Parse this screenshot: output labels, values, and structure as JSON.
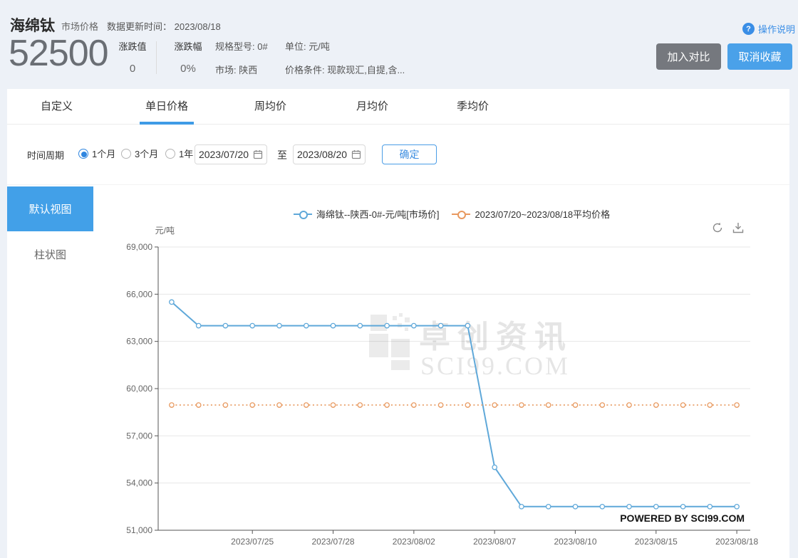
{
  "header": {
    "title": "海绵钛",
    "subtitle": "市场价格",
    "update_label": "数据更新时间：",
    "update_value": "2023/08/18",
    "help_label": "操作说明",
    "price": "52500",
    "change_label": "涨跌值",
    "change_value": "0",
    "change_pct_label": "涨跌幅",
    "change_pct_value": "0%",
    "spec_line": "规格型号: 0#",
    "market_line": "市场: 陕西",
    "unit_line": "单位: 元/吨",
    "condition_line": "价格条件: 现款现汇,自提,含...",
    "compare_button": "加入对比",
    "favorite_button": "取消收藏"
  },
  "tabs": [
    {
      "label": "自定义",
      "active": false
    },
    {
      "label": "单日价格",
      "active": true
    },
    {
      "label": "周均价",
      "active": false
    },
    {
      "label": "月均价",
      "active": false
    },
    {
      "label": "季均价",
      "active": false
    }
  ],
  "filter": {
    "period_label": "时间周期",
    "radios": [
      {
        "label": "1个月",
        "checked": true
      },
      {
        "label": "3个月",
        "checked": false
      },
      {
        "label": "1年",
        "checked": false
      }
    ],
    "date_from": "2023/07/20",
    "to_label": "至",
    "date_to": "2023/08/20",
    "confirm_button": "确定"
  },
  "sidebar": {
    "default_view": "默认视图",
    "bar_view": "柱状图"
  },
  "chart": {
    "unit_label": "元/吨",
    "watermark_cn": "卓创资讯",
    "watermark_en": "SCI99.COM",
    "powered_by": "POWERED BY SCI99.COM",
    "icons": {
      "refresh": "refresh-icon",
      "download": "download-icon"
    }
  },
  "chart_data": {
    "type": "line",
    "title": "",
    "ylabel": "元/吨",
    "ylim": [
      51000,
      69000
    ],
    "ytick_step": 3000,
    "grid": true,
    "legend_position": "top",
    "x": [
      "2023/07/20",
      "2023/07/21",
      "2023/07/24",
      "2023/07/25",
      "2023/07/26",
      "2023/07/27",
      "2023/07/28",
      "2023/07/31",
      "2023/08/01",
      "2023/08/02",
      "2023/08/03",
      "2023/08/04",
      "2023/08/07",
      "2023/08/08",
      "2023/08/09",
      "2023/08/10",
      "2023/08/11",
      "2023/08/14",
      "2023/08/15",
      "2023/08/16",
      "2023/08/17",
      "2023/08/18"
    ],
    "xtick_labels": [
      "2023/07/25",
      "2023/07/28",
      "2023/08/02",
      "2023/08/07",
      "2023/08/10",
      "2023/08/15",
      "2023/08/18"
    ],
    "xtick_indices": [
      3,
      6,
      9,
      12,
      15,
      18,
      21
    ],
    "series": [
      {
        "name": "海绵钛--陕西-0#-元/吨[市场价]",
        "color": "#5fa8d9",
        "style": "solid",
        "values": [
          65500,
          64000,
          64000,
          64000,
          64000,
          64000,
          64000,
          64000,
          64000,
          64000,
          64000,
          64000,
          55000,
          52500,
          52500,
          52500,
          52500,
          52500,
          52500,
          52500,
          52500,
          52500
        ]
      },
      {
        "name": "2023/07/20~2023/08/18平均价格",
        "color": "#e8995f",
        "style": "dotted",
        "values": [
          58954.55,
          58954.55,
          58954.55,
          58954.55,
          58954.55,
          58954.55,
          58954.55,
          58954.55,
          58954.55,
          58954.55,
          58954.55,
          58954.55,
          58954.55,
          58954.55,
          58954.55,
          58954.55,
          58954.55,
          58954.55,
          58954.55,
          58954.55,
          58954.55,
          58954.55
        ]
      }
    ]
  },
  "colors": {
    "accent_blue": "#3f9be6",
    "button_gray": "#75787e",
    "button_blue": "#4aa1e9",
    "sidebar_active": "#42a0e8",
    "series_blue": "#5fa8d9",
    "series_orange": "#e8995f",
    "help_blue": "#3a8ee6"
  }
}
